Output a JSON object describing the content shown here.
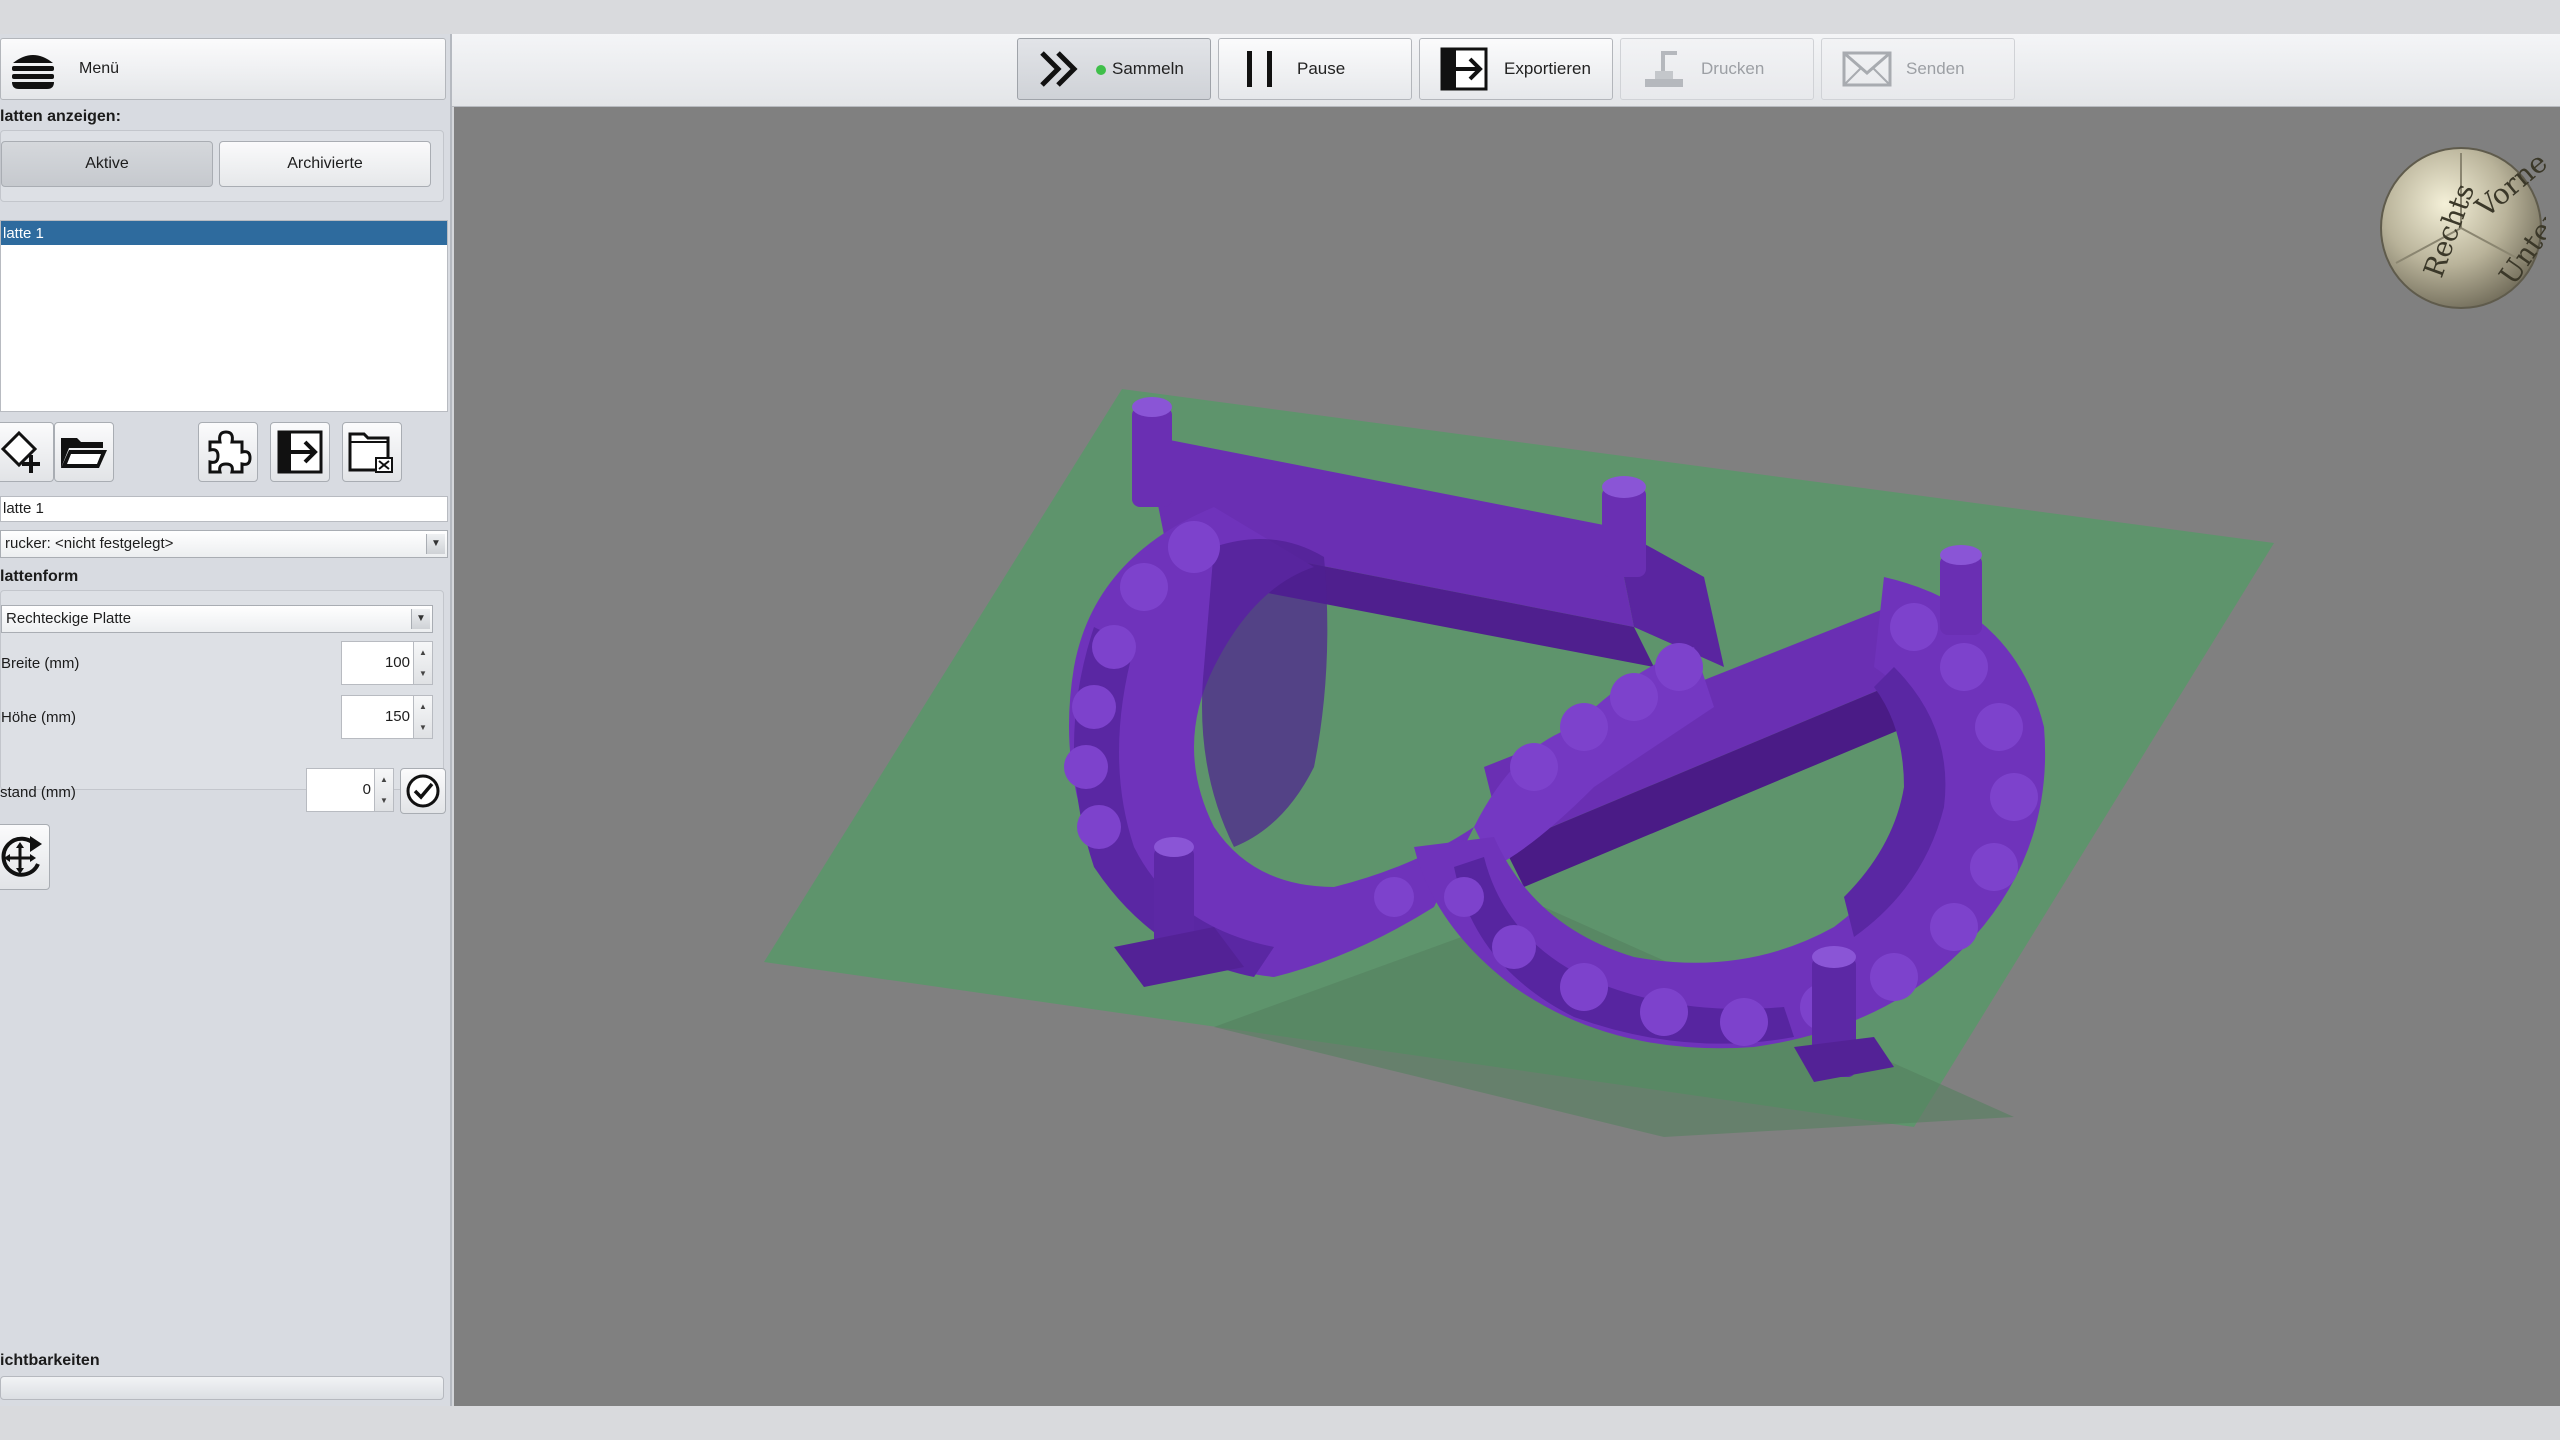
{
  "toolbar": {
    "buttons": [
      {
        "label": "Sammeln",
        "icon": "fast-forward-icon",
        "state": "active",
        "status_dot": "#3fbf4a"
      },
      {
        "label": "Pause",
        "icon": "pause-icon",
        "state": "normal"
      },
      {
        "label": "Exportieren",
        "icon": "export-icon",
        "state": "normal"
      },
      {
        "label": "Drucken",
        "icon": "printer-icon",
        "state": "disabled"
      },
      {
        "label": "Senden",
        "icon": "envelope-icon",
        "state": "disabled"
      }
    ]
  },
  "sidebar": {
    "menu_label": "Menü",
    "show_plates_label": "latten anzeigen:",
    "filter_buttons": [
      {
        "label": "Aktive",
        "selected": true
      },
      {
        "label": "Archivierte",
        "selected": false
      }
    ],
    "plate_list": [
      {
        "label": "latte 1",
        "selected": true
      }
    ],
    "plate_name_value": "latte 1",
    "printer_select": "rucker: <nicht festgelegt>",
    "plate_shape_label": "lattenform",
    "plate_shape_select": "Rechteckige Platte",
    "width_label": "Breite (mm)",
    "width_value": "100",
    "height_label": "Höhe (mm)",
    "height_value": "150",
    "spacing_label": "stand (mm)",
    "spacing_value": "0",
    "visibility_label": "ichtbarkeiten"
  },
  "viewport": {
    "background": "#808080",
    "plate_color": "#5e946c",
    "model_color": "#6a2fb3",
    "nav_cube_faces": [
      "Vorne",
      "Rechts",
      "Unten"
    ]
  }
}
